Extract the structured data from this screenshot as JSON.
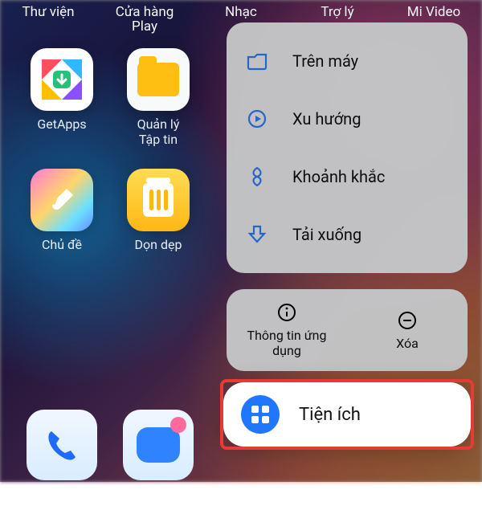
{
  "top": [
    {
      "label": "Thư viện"
    },
    {
      "label_line1": "Cửa hàng",
      "label_line2": "Play"
    },
    {
      "label": "Nhạc"
    },
    {
      "label": "Trợ lý"
    },
    {
      "label": "Mi Video"
    }
  ],
  "apps": {
    "getapps": "GetApps",
    "files_l1": "Quản lý",
    "files_l2": "Tập tin",
    "theme": "Chủ đề",
    "clean": "Dọn dẹp"
  },
  "menu": [
    {
      "icon": "folder",
      "label": "Trên máy"
    },
    {
      "icon": "play",
      "label": "Xu hướng"
    },
    {
      "icon": "moment",
      "label": "Khoảnh khắc"
    },
    {
      "icon": "download",
      "label": "Tải xuống"
    }
  ],
  "actions": {
    "info": "Thông tin ứng dụng",
    "remove": "Xóa"
  },
  "widgets_label": "Tiện ích",
  "colors": {
    "accent": "#2f83ff",
    "highlight": "#e63a36"
  }
}
